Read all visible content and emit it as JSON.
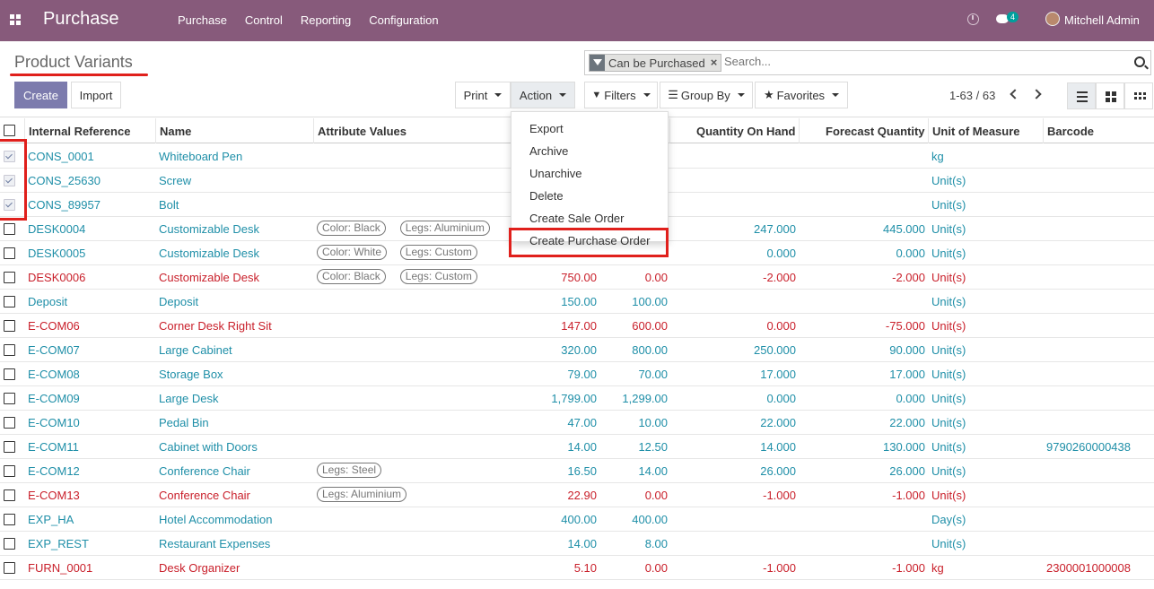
{
  "app": {
    "brand": "Purchase",
    "menu": [
      "Purchase",
      "Control",
      "Reporting",
      "Configuration"
    ],
    "chat_count": "4",
    "user": "Mitchell Admin"
  },
  "control_panel": {
    "title": "Product Variants",
    "facet": "Can be Purchased",
    "search_placeholder": "Search...",
    "create_label": "Create",
    "import_label": "Import",
    "print_label": "Print",
    "action_label": "Action",
    "filters_label": "Filters",
    "groupby_label": "Group By",
    "favorites_label": "Favorites",
    "pager": "1-63 / 63"
  },
  "columns": [
    "Internal Reference",
    "Name",
    "Attribute Values",
    "Quantity On Hand",
    "Forecast Quantity",
    "Unit of Measure",
    "Barcode"
  ],
  "action_menu": [
    "Export",
    "Archive",
    "Unarchive",
    "Delete",
    "Create Sale Order",
    "Create Purchase Order"
  ],
  "rows": [
    {
      "ref": "CONS_0001",
      "name": "Whiteboard Pen",
      "tags": [],
      "price": "",
      "cost": "",
      "qty": "",
      "forecast": "",
      "uom": "kg",
      "barcode": "",
      "red": false,
      "checked": true
    },
    {
      "ref": "CONS_25630",
      "name": "Screw",
      "tags": [],
      "price": "",
      "cost": "",
      "qty": "",
      "forecast": "",
      "uom": "Unit(s)",
      "barcode": "",
      "red": false,
      "checked": true
    },
    {
      "ref": "CONS_89957",
      "name": "Bolt",
      "tags": [],
      "price": "",
      "cost": "",
      "qty": "",
      "forecast": "",
      "uom": "Unit(s)",
      "barcode": "",
      "red": false,
      "checked": true
    },
    {
      "ref": "DESK0004",
      "name": "Customizable Desk",
      "tags": [
        "Color: Black",
        "Legs: Aluminium"
      ],
      "price": "",
      "cost": "",
      "qty": "247.000",
      "forecast": "445.000",
      "uom": "Unit(s)",
      "barcode": "",
      "red": false,
      "checked": false
    },
    {
      "ref": "DESK0005",
      "name": "Customizable Desk",
      "tags": [
        "Color: White",
        "Legs: Custom"
      ],
      "price": "",
      "cost": "",
      "qty": "0.000",
      "forecast": "0.000",
      "uom": "Unit(s)",
      "barcode": "",
      "red": false,
      "checked": false
    },
    {
      "ref": "DESK0006",
      "name": "Customizable Desk",
      "tags": [
        "Color: Black",
        "Legs: Custom"
      ],
      "price": "750.00",
      "cost": "0.00",
      "qty": "-2.000",
      "forecast": "-2.000",
      "uom": "Unit(s)",
      "barcode": "",
      "red": true,
      "checked": false
    },
    {
      "ref": "Deposit",
      "name": "Deposit",
      "tags": [],
      "price": "150.00",
      "cost": "100.00",
      "qty": "",
      "forecast": "",
      "uom": "Unit(s)",
      "barcode": "",
      "red": false,
      "checked": false
    },
    {
      "ref": "E-COM06",
      "name": "Corner Desk Right Sit",
      "tags": [],
      "price": "147.00",
      "cost": "600.00",
      "qty": "0.000",
      "forecast": "-75.000",
      "uom": "Unit(s)",
      "barcode": "",
      "red": true,
      "checked": false
    },
    {
      "ref": "E-COM07",
      "name": "Large Cabinet",
      "tags": [],
      "price": "320.00",
      "cost": "800.00",
      "qty": "250.000",
      "forecast": "90.000",
      "uom": "Unit(s)",
      "barcode": "",
      "red": false,
      "checked": false
    },
    {
      "ref": "E-COM08",
      "name": "Storage Box",
      "tags": [],
      "price": "79.00",
      "cost": "70.00",
      "qty": "17.000",
      "forecast": "17.000",
      "uom": "Unit(s)",
      "barcode": "",
      "red": false,
      "checked": false
    },
    {
      "ref": "E-COM09",
      "name": "Large Desk",
      "tags": [],
      "price": "1,799.00",
      "cost": "1,299.00",
      "qty": "0.000",
      "forecast": "0.000",
      "uom": "Unit(s)",
      "barcode": "",
      "red": false,
      "checked": false
    },
    {
      "ref": "E-COM10",
      "name": "Pedal Bin",
      "tags": [],
      "price": "47.00",
      "cost": "10.00",
      "qty": "22.000",
      "forecast": "22.000",
      "uom": "Unit(s)",
      "barcode": "",
      "red": false,
      "checked": false
    },
    {
      "ref": "E-COM11",
      "name": "Cabinet with Doors",
      "tags": [],
      "price": "14.00",
      "cost": "12.50",
      "qty": "14.000",
      "forecast": "130.000",
      "uom": "Unit(s)",
      "barcode": "9790260000438",
      "red": false,
      "checked": false
    },
    {
      "ref": "E-COM12",
      "name": "Conference Chair",
      "tags": [
        "Legs: Steel"
      ],
      "price": "16.50",
      "cost": "14.00",
      "qty": "26.000",
      "forecast": "26.000",
      "uom": "Unit(s)",
      "barcode": "",
      "red": false,
      "checked": false
    },
    {
      "ref": "E-COM13",
      "name": "Conference Chair",
      "tags": [
        "Legs: Aluminium"
      ],
      "price": "22.90",
      "cost": "0.00",
      "qty": "-1.000",
      "forecast": "-1.000",
      "uom": "Unit(s)",
      "barcode": "",
      "red": true,
      "checked": false
    },
    {
      "ref": "EXP_HA",
      "name": "Hotel Accommodation",
      "tags": [],
      "price": "400.00",
      "cost": "400.00",
      "qty": "",
      "forecast": "",
      "uom": "Day(s)",
      "barcode": "",
      "red": false,
      "checked": false
    },
    {
      "ref": "EXP_REST",
      "name": "Restaurant Expenses",
      "tags": [],
      "price": "14.00",
      "cost": "8.00",
      "qty": "",
      "forecast": "",
      "uom": "Unit(s)",
      "barcode": "",
      "red": false,
      "checked": false
    },
    {
      "ref": "FURN_0001",
      "name": "Desk Organizer",
      "tags": [],
      "price": "5.10",
      "cost": "0.00",
      "qty": "-1.000",
      "forecast": "-1.000",
      "uom": "kg",
      "barcode": "2300001000008",
      "red": true,
      "checked": false
    }
  ]
}
